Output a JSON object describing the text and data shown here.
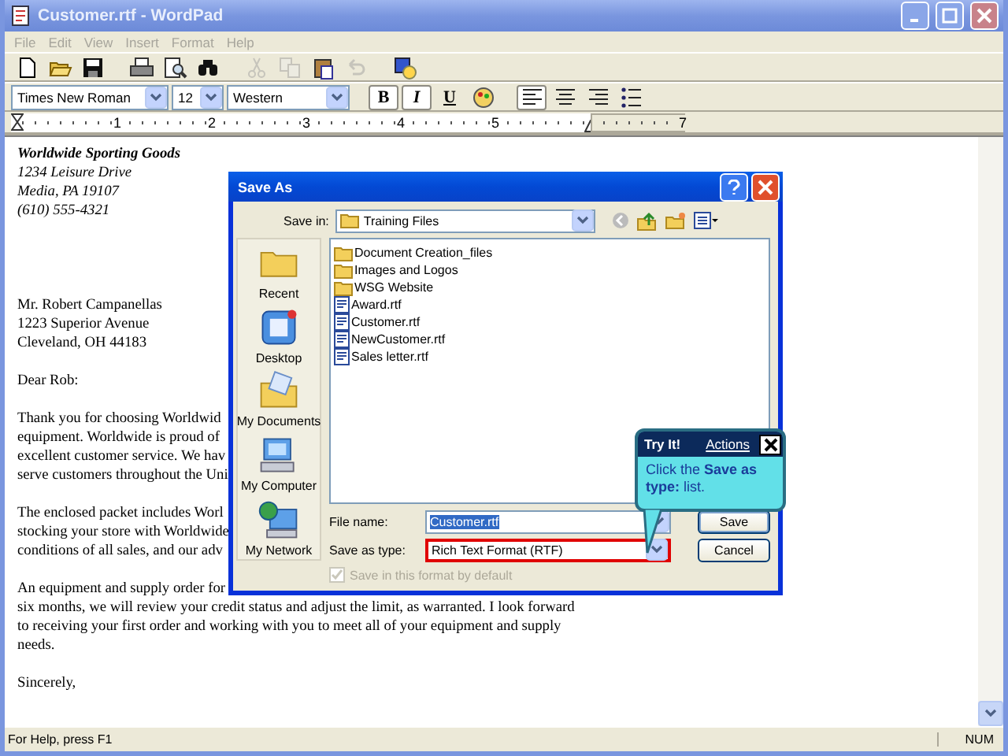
{
  "window": {
    "title": "Customer.rtf - WordPad"
  },
  "menu": [
    "File",
    "Edit",
    "View",
    "Insert",
    "Format",
    "Help"
  ],
  "toolbar": [
    {
      "kind": "new",
      "disabled": false
    },
    {
      "kind": "open",
      "disabled": false
    },
    {
      "kind": "save",
      "disabled": false
    },
    {
      "kind": "print",
      "disabled": false
    },
    {
      "kind": "preview",
      "disabled": false
    },
    {
      "kind": "find",
      "disabled": false
    },
    {
      "kind": "cut",
      "disabled": true
    },
    {
      "kind": "copy",
      "disabled": true
    },
    {
      "kind": "paste",
      "disabled": false
    },
    {
      "kind": "undo",
      "disabled": true
    },
    {
      "kind": "datetime",
      "disabled": false
    }
  ],
  "format_bar": {
    "font": "Times New Roman",
    "size": "12",
    "script": "Western",
    "buttons": [
      {
        "kind": "bold",
        "label": "B",
        "pressed": true
      },
      {
        "kind": "italic",
        "label": "I",
        "pressed": true
      },
      {
        "kind": "underline",
        "label": "U",
        "pressed": false
      },
      {
        "kind": "color",
        "pressed": false
      },
      {
        "kind": "align-left",
        "pressed": true
      },
      {
        "kind": "align-center",
        "pressed": false
      },
      {
        "kind": "align-right",
        "pressed": false
      },
      {
        "kind": "bullets",
        "pressed": false
      }
    ]
  },
  "ruler": {
    "numbers": [
      "1",
      "2",
      "3",
      "4",
      "5",
      "7"
    ]
  },
  "document": {
    "paragraphs": [
      {
        "kind": "letterhead",
        "lines": [
          "Worldwide Sporting Goods",
          "1234 Leisure Drive",
          "Media, PA 19107",
          "(610) 555-4321"
        ]
      },
      {
        "kind": "body",
        "lines": [
          "Mr. Robert Campanellas",
          "1223 Superior Avenue",
          "Cleveland, OH  44183"
        ]
      },
      {
        "kind": "body",
        "lines": [
          "Dear Rob:"
        ]
      },
      {
        "kind": "body",
        "lines": [
          "Thank you for choosing Worldwid",
          "equipment. Worldwide is proud of",
          "excellent customer service. We hav",
          "serve customers throughout the Uni"
        ]
      },
      {
        "kind": "body",
        "lines": [
          "The enclosed packet includes Worl",
          "stocking your store with Worldwide",
          "conditions of all sales, and our adv"
        ]
      },
      {
        "kind": "body",
        "lines": [
          "An equipment and supply order for",
          "six months, we will review your credit status and adjust the limit, as warranted. I look forward",
          "to receiving your first order and working with you to meet all of your equipment and supply",
          "needs."
        ]
      },
      {
        "kind": "body",
        "lines": [
          "Sincerely,"
        ]
      }
    ]
  },
  "dialog": {
    "title": "Save As",
    "save_in": {
      "label": "Save in:",
      "value": "Training Files"
    },
    "places": [
      {
        "kind": "recent",
        "label": "Recent"
      },
      {
        "kind": "desktop",
        "label": "Desktop"
      },
      {
        "kind": "documents",
        "label": "My Documents"
      },
      {
        "kind": "computer",
        "label": "My Computer"
      },
      {
        "kind": "network",
        "label": "My Network"
      }
    ],
    "files": [
      {
        "kind": "folder",
        "name": "Document Creation_files"
      },
      {
        "kind": "folder",
        "name": "Images and Logos"
      },
      {
        "kind": "folder",
        "name": "WSG Website"
      },
      {
        "kind": "rtf",
        "name": "Award.rtf"
      },
      {
        "kind": "rtf",
        "name": "Customer.rtf"
      },
      {
        "kind": "rtf",
        "name": "NewCustomer.rtf"
      },
      {
        "kind": "rtf",
        "name": "Sales letter.rtf"
      }
    ],
    "file_name": {
      "label": "File name:",
      "value": "Customer.rtf",
      "selected": true
    },
    "save_as_type": {
      "label": "Save as type:",
      "value": "Rich Text Format (RTF)",
      "highlighted": true
    },
    "buttons": [
      "Save",
      "Cancel"
    ],
    "default_checkbox": {
      "label": "Save in this format by default",
      "checked": true,
      "disabled": true
    }
  },
  "tooltip": {
    "title": "Try It!",
    "link": "Actions",
    "text": "Click the **Save as type:** list."
  },
  "status_bar": {
    "text": "For Help, press F1",
    "indicator": "NUM"
  }
}
